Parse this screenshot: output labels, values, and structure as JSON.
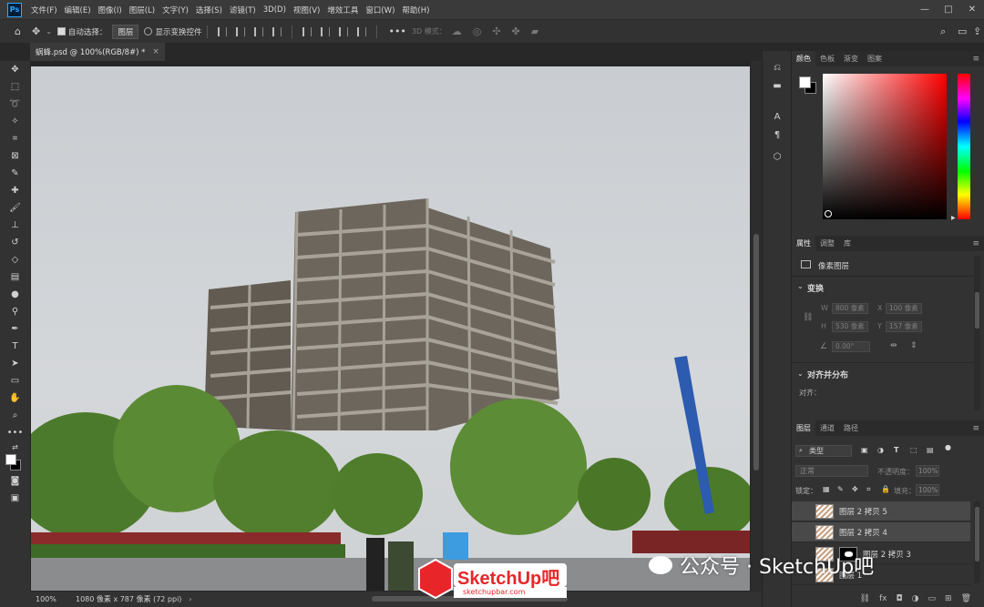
{
  "menubar": {
    "items": [
      "文件(F)",
      "编辑(E)",
      "图像(I)",
      "图层(L)",
      "文字(Y)",
      "选择(S)",
      "滤镜(T)",
      "3D(D)",
      "视图(V)",
      "增效工具",
      "窗口(W)",
      "帮助(H)"
    ],
    "logo": "Ps"
  },
  "options": {
    "auto_select_label": "自动选择：",
    "auto_select_value": "图层",
    "show_transform_label": "显示变换控件",
    "mode3d_label": "3D 模式："
  },
  "document": {
    "tab_title": "蜗蜂.psd @ 100%(RGB/8#) *",
    "zoom": "100%",
    "doc_info": "1080 像素 x 787 像素 (72 ppi)"
  },
  "color_panel": {
    "tabs": [
      "颜色",
      "色板",
      "渐变",
      "图案"
    ],
    "accent_colors": [
      "#ff0000",
      "#000000",
      "#ffffff"
    ]
  },
  "properties_panel": {
    "tabs": [
      "属性",
      "调整",
      "库"
    ],
    "layer_type": "像素图层",
    "transform_title": "变换",
    "w_label": "W",
    "w_value": "800 像素",
    "x_label": "X",
    "x_value": "100 像素",
    "h_label": "H",
    "h_value": "530 像素",
    "y_label": "Y",
    "y_value": "157 像素",
    "angle_value": "0.00°",
    "align_title": "对齐并分布",
    "align_label": "对齐："
  },
  "layers_panel": {
    "tabs": [
      "图层",
      "通道",
      "路径"
    ],
    "filter_kind": "类型",
    "blend_mode": "正常",
    "opacity_label": "不透明度：",
    "opacity_value": "100%",
    "lock_label": "锁定：",
    "fill_label": "填充：",
    "fill_value": "100%",
    "layers": [
      {
        "name": "图层 2 拷贝 5"
      },
      {
        "name": "图层 2 拷贝 4"
      },
      {
        "name": "图层 2 拷贝 3"
      },
      {
        "name": "图层 1"
      }
    ]
  },
  "watermark": {
    "wechat_text": "公众号 · SketchUp吧",
    "logo_text": "SketchUp吧",
    "logo_sub": "sketchupbar.com"
  }
}
